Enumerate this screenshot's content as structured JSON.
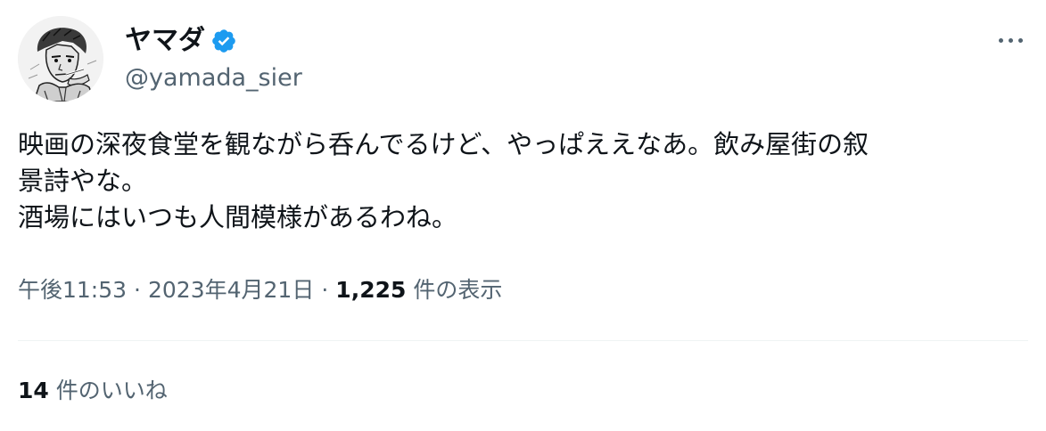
{
  "user": {
    "display_name": "ヤマダ",
    "handle": "@yamada_sier",
    "verified": true,
    "verified_color": "#1d9bf0"
  },
  "tweet": {
    "lines": [
      "映画の深夜食堂を観ながら呑んでるけど、やっぱええなあ。飲み屋街の叙",
      "景詩やな。",
      "酒場にはいつも人間模様があるわね。"
    ],
    "time": "午後11:53",
    "date": "2023年4月21日",
    "separator": "·",
    "views_count": "1,225",
    "views_label": "件の表示"
  },
  "engagement": {
    "likes_count": "14",
    "likes_label": "件のいいね"
  },
  "icons": {
    "more": "more-options-icon",
    "verified": "verified-badge-icon"
  },
  "colors": {
    "text": "#0f1419",
    "secondary": "#536471",
    "divider": "#eff3f4"
  }
}
